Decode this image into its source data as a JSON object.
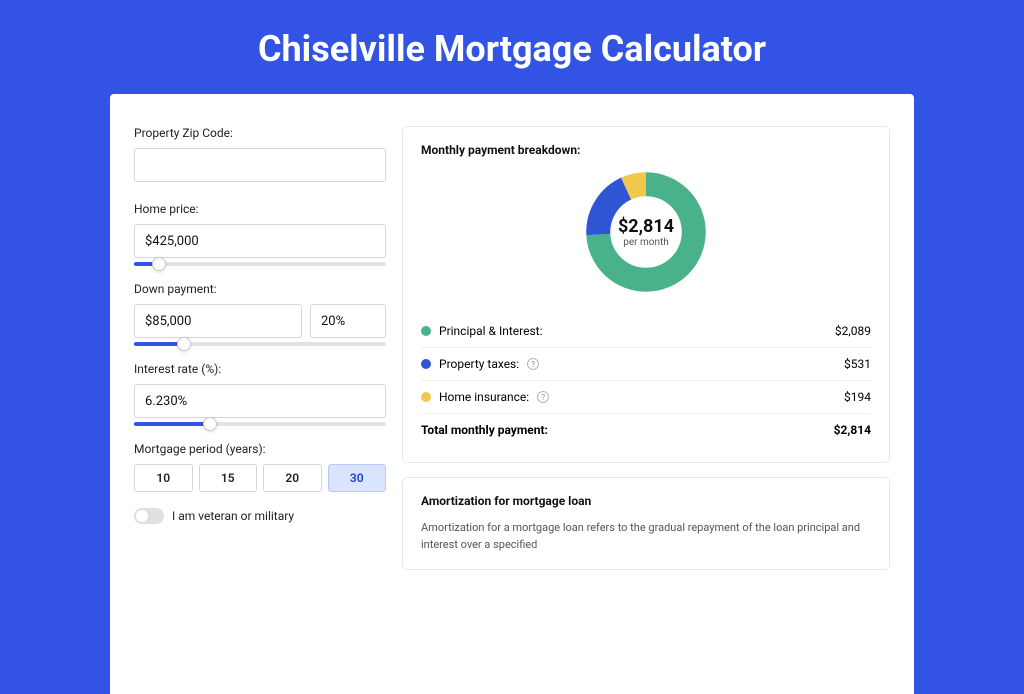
{
  "title": "Chiselville Mortgage Calculator",
  "colors": {
    "accent": "#3353e5",
    "green": "#49b28b",
    "blue": "#2f55d4",
    "yellow": "#f1c84c"
  },
  "form": {
    "zip": {
      "label": "Property Zip Code:",
      "value": ""
    },
    "price": {
      "label": "Home price:",
      "value": "$425,000",
      "slider_pct": 10
    },
    "down": {
      "label": "Down payment:",
      "value": "$85,000",
      "pct": "20%",
      "slider_pct": 20
    },
    "rate": {
      "label": "Interest rate (%):",
      "value": "6.230%",
      "slider_pct": 30
    },
    "term": {
      "label": "Mortgage period (years):",
      "options": [
        "10",
        "15",
        "20",
        "30"
      ],
      "selected": "30"
    },
    "veteran": {
      "label": "I am veteran or military",
      "on": false
    }
  },
  "breakdown": {
    "title": "Monthly payment breakdown:",
    "center_amount": "$2,814",
    "center_sub": "per month",
    "items": [
      {
        "label": "Principal & Interest:",
        "value": "$2,089",
        "color": "#49b28b",
        "info": false,
        "pct": 74
      },
      {
        "label": "Property taxes:",
        "value": "$531",
        "color": "#2f55d4",
        "info": true,
        "pct": 19
      },
      {
        "label": "Home insurance:",
        "value": "$194",
        "color": "#f1c84c",
        "info": true,
        "pct": 7
      }
    ],
    "total": {
      "label": "Total monthly payment:",
      "value": "$2,814"
    }
  },
  "amort": {
    "title": "Amortization for mortgage loan",
    "text": "Amortization for a mortgage loan refers to the gradual repayment of the loan principal and interest over a specified"
  },
  "chart_data": {
    "type": "pie",
    "title": "Monthly payment breakdown",
    "series": [
      {
        "name": "Principal & Interest",
        "value": 2089
      },
      {
        "name": "Property taxes",
        "value": 531
      },
      {
        "name": "Home insurance",
        "value": 194
      }
    ],
    "total": 2814,
    "unit": "$ per month"
  }
}
